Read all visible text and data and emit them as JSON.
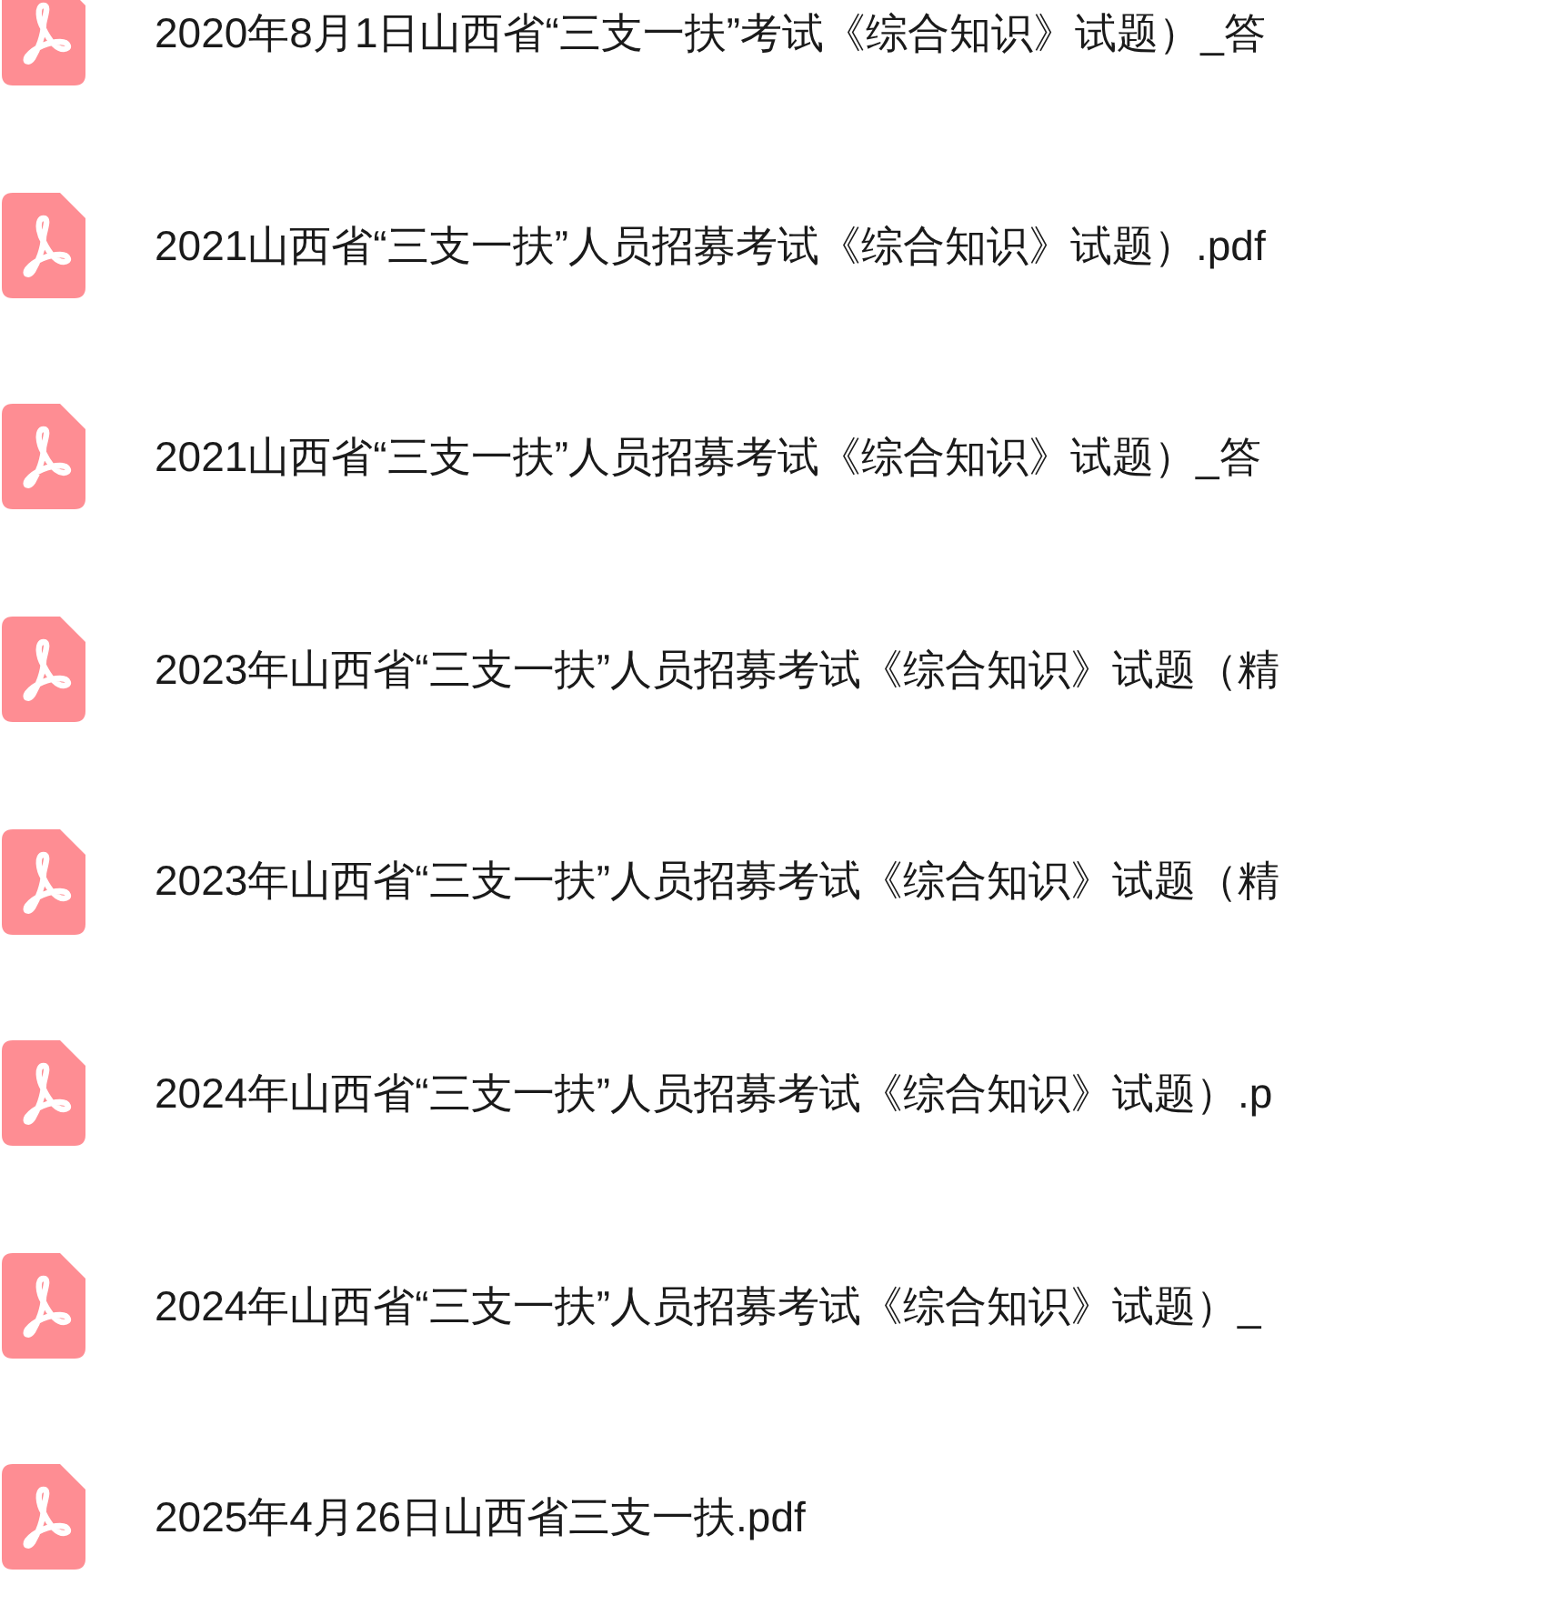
{
  "files": [
    {
      "name": "2020年8月1日山西省“三支一扶”考试《综合知识》试题）_答"
    },
    {
      "name": "2021山西省“三支一扶”人员招募考试《综合知识》试题）.pdf"
    },
    {
      "name": "2021山西省“三支一扶”人员招募考试《综合知识》试题）_答"
    },
    {
      "name": "2023年山西省“三支一扶”人员招募考试《综合知识》试题（精"
    },
    {
      "name": "2023年山西省“三支一扶”人员招募考试《综合知识》试题（精"
    },
    {
      "name": "2024年山西省“三支一扶”人员招募考试《综合知识》试题）.p"
    },
    {
      "name": "2024年山西省“三支一扶”人员招募考试《综合知识》试题）_"
    },
    {
      "name": "2025年4月26日山西省三支一扶.pdf"
    }
  ]
}
